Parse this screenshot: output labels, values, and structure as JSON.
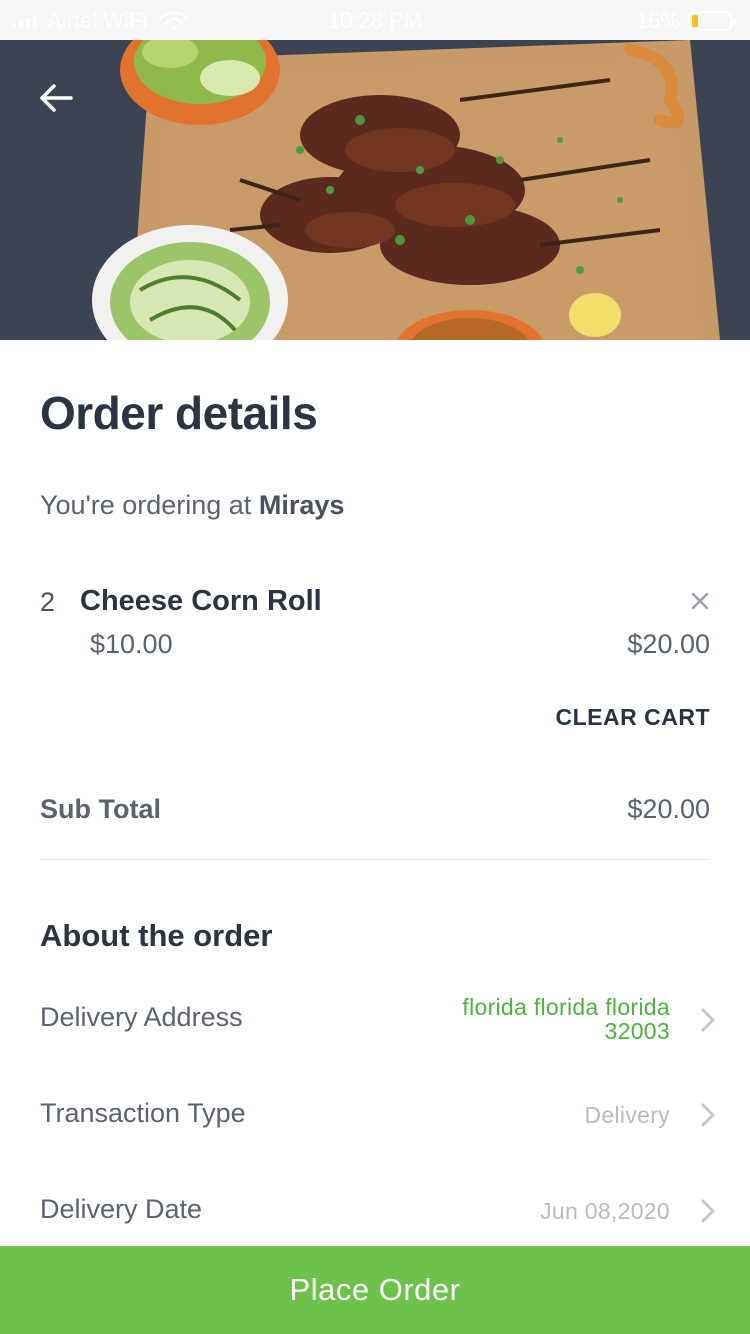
{
  "status_bar": {
    "carrier": "Airtel WiFi",
    "time": "10:28 PM",
    "battery_text": "16%",
    "battery_level": 0.16,
    "battery_color": "#f5c518"
  },
  "hero": {
    "back_icon": "arrow-left-icon"
  },
  "page": {
    "title": "Order details",
    "ordering_prefix": "You're ordering at",
    "restaurant": "Mirays"
  },
  "cart": {
    "items": [
      {
        "quantity": "2",
        "name": "Cheese Corn Roll",
        "unit_price": "$10.00",
        "total": "$20.00",
        "remove_icon": "close-icon"
      }
    ],
    "clear_label": "CLEAR CART",
    "subtotal_label": "Sub Total",
    "subtotal_value": "$20.00"
  },
  "about": {
    "title": "About the order",
    "rows": [
      {
        "label": "Delivery Address",
        "value_line1": "florida florida florida",
        "value_line2": "32003",
        "value_color": "#4db33d",
        "icon": "chevron-right-icon"
      },
      {
        "label": "Transaction Type",
        "value": "Delivery",
        "icon": "chevron-right-icon"
      },
      {
        "label": "Delivery Date",
        "value": "Jun 08,2020",
        "icon": "chevron-right-icon"
      }
    ]
  },
  "footer": {
    "place_order_label": "Place Order",
    "button_color": "#6cc24a"
  }
}
